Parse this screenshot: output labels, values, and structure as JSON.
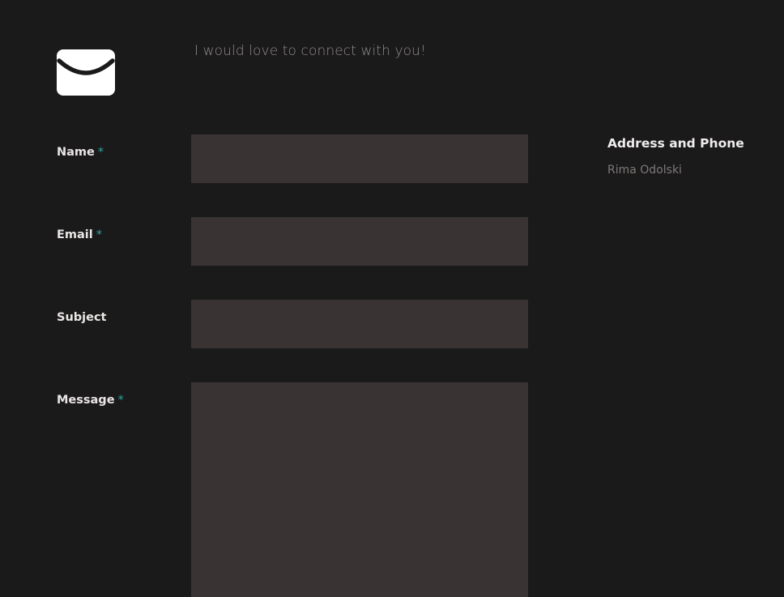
{
  "header": {
    "icon": "envelope-icon",
    "tagline": "I would love to connect with you!"
  },
  "form": {
    "required_marker": "*",
    "fields": [
      {
        "label": "Name",
        "required": true,
        "value": "",
        "type": "text"
      },
      {
        "label": "Email",
        "required": true,
        "value": "",
        "type": "text"
      },
      {
        "label": "Subject",
        "required": false,
        "value": "",
        "type": "text"
      },
      {
        "label": "Message",
        "required": true,
        "value": "",
        "type": "textarea"
      }
    ]
  },
  "aside": {
    "title": "Address and Phone",
    "name": "Rima Odolski"
  },
  "colors": {
    "background": "#1b1a1a",
    "field_background": "#393333",
    "required_accent": "#2aa6a0",
    "label_text": "#e9e6e5",
    "muted_text": "#8f8b8a"
  }
}
